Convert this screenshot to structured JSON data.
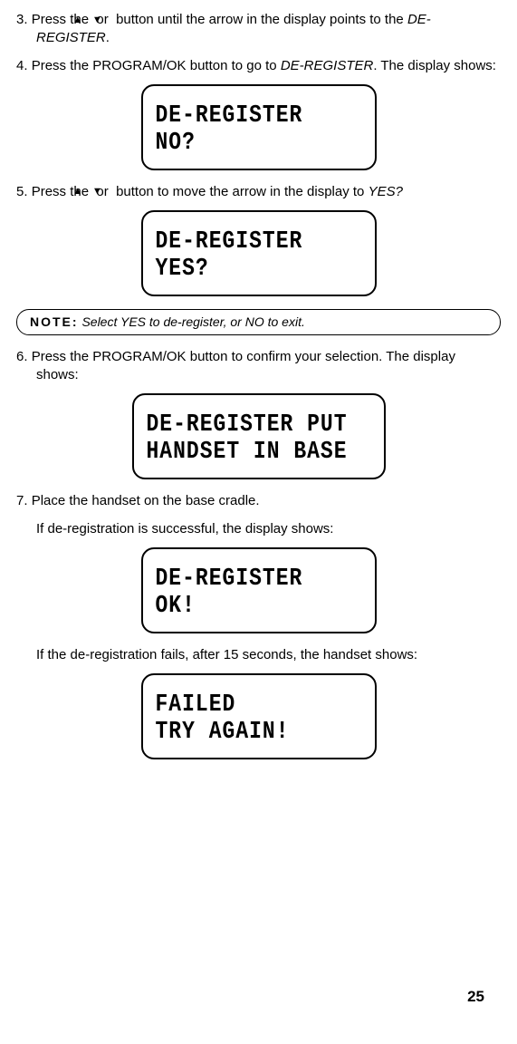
{
  "icons": {
    "up": "▲",
    "down": "▼"
  },
  "steps": {
    "s3": {
      "num": "3.",
      "before": "Press the ",
      "mid": " or ",
      "after": " button until the arrow in the display points to the ",
      "target": "DE-REGISTER",
      "end": "."
    },
    "s4": {
      "num": "4.",
      "before": "Press the PROGRAM/OK button to go to ",
      "target": "DE-REGISTER",
      "after": ". The display shows:"
    },
    "s5": {
      "num": "5.",
      "before": "Press the ",
      "mid": " or ",
      "after": " button to move the arrow in the display to ",
      "target": "YES?"
    },
    "s6": {
      "num": "6.",
      "text": "Press the PROGRAM/OK button to confirm your selection. The display shows:"
    },
    "s7": {
      "num": "7.",
      "text": "Place the handset on the base cradle."
    }
  },
  "bodylines": {
    "b1": "If de-registration is successful, the display shows:",
    "b2": "If the de-registration fails, after 15 seconds, the handset shows:"
  },
  "note": {
    "label": "NOTE:",
    "text": " Select YES to de-register, or NO to exit."
  },
  "screens": {
    "sc1": "DE-REGISTER\nNO?",
    "sc2": "DE-REGISTER\nYES?",
    "sc3": "DE-REGISTER PUT\nHANDSET IN BASE",
    "sc4": "DE-REGISTER\nOK!",
    "sc5": "FAILED\nTRY AGAIN!"
  },
  "page_number": "25"
}
